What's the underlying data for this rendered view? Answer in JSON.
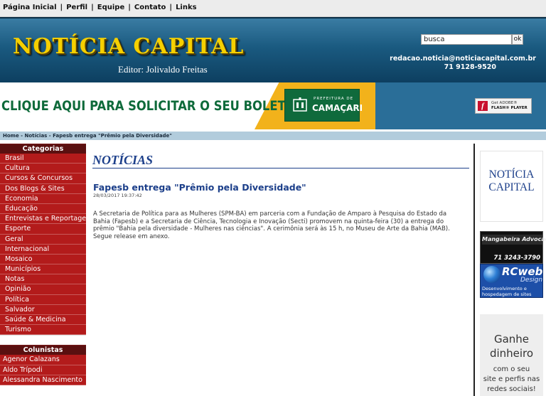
{
  "topnav": {
    "items": [
      "Página Inicial",
      "Perfil",
      "Equipe",
      "Contato",
      "Links"
    ],
    "separator": "|"
  },
  "header": {
    "logo_title": "NOTÍCIA CAPITAL",
    "logo_editor": "Editor: Jolivaldo Freitas",
    "search_value": "busca",
    "search_button": "ok",
    "email": "redacao.noticia@noticiacapital.com.br",
    "phone": "71 9128-9520"
  },
  "banner": {
    "cta": "CLIQUE AQUI PARA SOLICITAR O SEU BOLETO.",
    "prefeitura_small": "PREFEITURA DE",
    "prefeitura_big": "CAMAÇARI",
    "flash_get": "Get ADOBE®",
    "flash_name": "FLASH® PLAYER"
  },
  "breadcrumb": "Home - Notícias - Fapesb entrega \"Prêmio pela Diversidade\"",
  "sidebar": {
    "categories_title": "Categorias",
    "categories": [
      "Brasil",
      "Cultura",
      "Cursos & Concursos",
      "Dos Blogs & Sites",
      "Economia",
      "Educação",
      "Entrevistas e Reportagens",
      "Esporte",
      "Geral",
      "Internacional",
      "Mosaico",
      "Municípios",
      "Notas",
      "Opinião",
      "Política",
      "Salvador",
      "Saúde & Medicina",
      "Turismo"
    ],
    "columnists_title": "Colunistas",
    "columnists": [
      "Agenor Calazans",
      "Aldo Trípodi",
      "Alessandra Nascimento"
    ]
  },
  "main": {
    "section_title": "NOTÍCIAS",
    "article_title": "Fapesb entrega \"Prêmio pela Diversidade\"",
    "article_date": "28/03/2017 19:37:42",
    "article_body": "A Secretaria de Política para as Mulheres (SPM-BA) em parceria com a Fundação de Amparo à Pesquisa do Estado da Bahia (Fapesb) e a Secretaria de Ciência, Tecnologia e Inovação (Secti) promovem na quinta-feira (30) a entrega do prêmio \"Bahia pela diversidade - Mulheres nas ciências\". A cerimônia será às 15 h, no Museu de Arte da Bahia (MAB). Segue release em anexo."
  },
  "rightcol": {
    "nc_line1": "NOTÍCIA",
    "nc_line2": "CAPITAL",
    "mangabeira_title": "Mangabeira Advocacia",
    "mangabeira_phone": "71 3243-3790",
    "rc_logo": "RCweb",
    "rc_design": "Design",
    "rc_line1": "Desenvolvimento e",
    "rc_line2": "hospedagem de sites",
    "ganhe_1": "Ganhe",
    "ganhe_2": "dinheiro",
    "ganhe_3": "com o seu",
    "ganhe_4": "site e perfis nas",
    "ganhe_5": "redes sociais!"
  }
}
